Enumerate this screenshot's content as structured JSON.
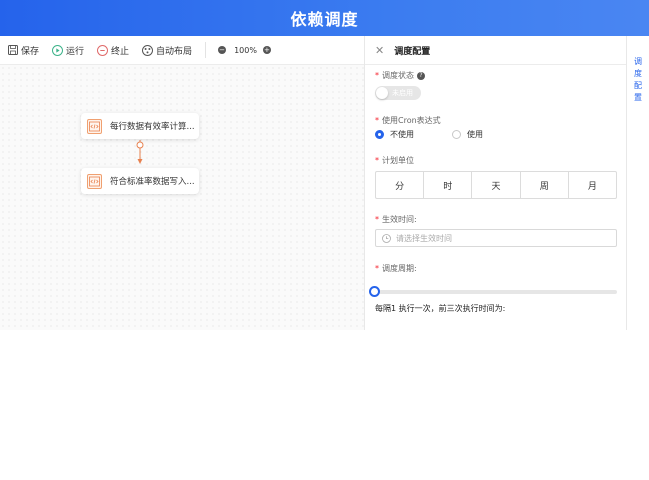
{
  "header": {
    "title": "依赖调度"
  },
  "toolbar": {
    "save_label": "保存",
    "run_label": "运行",
    "stop_label": "终止",
    "autolayout_label": "自动布局",
    "zoom_value": "100%"
  },
  "canvas": {
    "nodes": [
      {
        "label": "每行数据有效率计算..."
      },
      {
        "label": "符合标准率数据写入..."
      }
    ]
  },
  "panel": {
    "title": "调度配置",
    "fields": {
      "status": {
        "label": "调度状态",
        "switch_text": "未启用"
      },
      "cron": {
        "label": "使用Cron表达式",
        "options": [
          "不使用",
          "使用"
        ],
        "selected": "不使用"
      },
      "unit": {
        "label": "计划单位",
        "options": [
          "分",
          "时",
          "天",
          "周",
          "月"
        ]
      },
      "effective_time": {
        "label": "生效时间:",
        "placeholder": "请选择生效时间"
      },
      "period": {
        "label": "调度周期:",
        "slider_value": 1
      },
      "next_run_text": "每隔1 执行一次，前三次执行时间为:"
    }
  },
  "side_strip": {
    "tab_label": "调度配置"
  },
  "colors": {
    "primary": "#2563eb",
    "node_accent": "#f0a070",
    "edge": "#e8814f"
  }
}
